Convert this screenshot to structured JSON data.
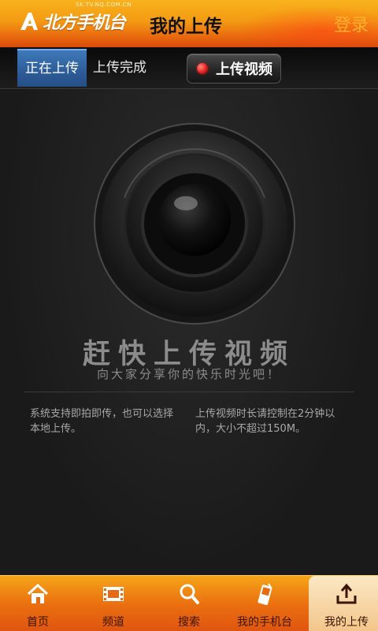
{
  "header": {
    "logo_text": "北方手机台",
    "logo_url": "SK.TV.NQ.COM.CN",
    "title": "我的上传",
    "login": "登录"
  },
  "tabs": {
    "uploading": "正在上传",
    "completed": "上传完成",
    "upload_video": "上传视频"
  },
  "main": {
    "headline": "赶快上传视频",
    "subline": "向大家分享你的快乐时光吧！",
    "tip_left": "系统支持即拍即传，也可以选择本地上传。",
    "tip_right": "上传视频时长请控制在2分钟以内，大小不超过150M。"
  },
  "nav": {
    "home": "首页",
    "channels": "频道",
    "search": "搜索",
    "my_phone_tv": "我的手机台",
    "my_upload": "我的上传"
  },
  "colors": {
    "header_orange": "#f39a14",
    "active_tab_blue": "#2d5c98",
    "record_red": "#e02020"
  }
}
